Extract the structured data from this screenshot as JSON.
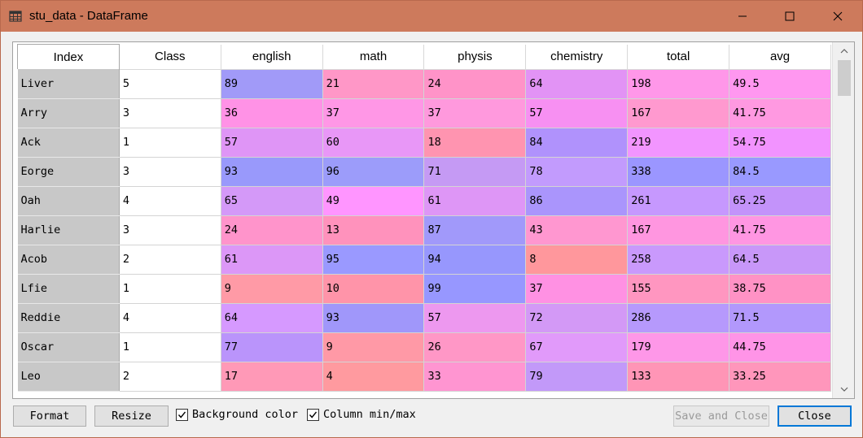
{
  "window": {
    "title": "stu_data - DataFrame"
  },
  "table": {
    "columns": [
      "Index",
      "Class",
      "english",
      "math",
      "physis",
      "chemistry",
      "total",
      "avg"
    ],
    "rows": [
      {
        "cells": [
          "Liver",
          "5",
          "89",
          "21",
          "24",
          "64",
          "198",
          "49.5"
        ],
        "colors": [
          "",
          "",
          "#a19af8",
          "#ff97c7",
          "#ff93c8",
          "#e293f5",
          "#ff97e9",
          "#ff97f0"
        ]
      },
      {
        "cells": [
          "Arry",
          "3",
          "36",
          "37",
          "37",
          "57",
          "167",
          "41.75"
        ],
        "colors": [
          "",
          "",
          "#ff92e6",
          "#ff97e6",
          "#ff99dd",
          "#f790f2",
          "#ff99cf",
          "#ff99e1"
        ]
      },
      {
        "cells": [
          "Ack",
          "1",
          "57",
          "60",
          "18",
          "84",
          "219",
          "54.75"
        ],
        "colors": [
          "",
          "",
          "#df95f6",
          "#e897f7",
          "#ff94b0",
          "#b092fc",
          "#f295ff",
          "#f293ff"
        ]
      },
      {
        "cells": [
          "Eorge",
          "3",
          "93",
          "96",
          "71",
          "78",
          "338",
          "84.5"
        ],
        "colors": [
          "",
          "",
          "#9999fb",
          "#9c9cfa",
          "#c59af4",
          "#c29bfd",
          "#9b96ff",
          "#9999ff"
        ]
      },
      {
        "cells": [
          "Oah",
          "4",
          "65",
          "49",
          "61",
          "86",
          "261",
          "65.25"
        ],
        "colors": [
          "",
          "",
          "#d499f8",
          "#ff95ff",
          "#de96f6",
          "#aa95fc",
          "#c698fe",
          "#c393fa"
        ]
      },
      {
        "cells": [
          "Harlie",
          "3",
          "24",
          "13",
          "87",
          "43",
          "167",
          "41.75"
        ],
        "colors": [
          "",
          "",
          "#ff94cb",
          "#ff92bc",
          "#a199fa",
          "#ff97d0",
          "#ff96e0",
          "#ff96e2"
        ]
      },
      {
        "cells": [
          "Acob",
          "2",
          "61",
          "95",
          "94",
          "8",
          "258",
          "64.5"
        ],
        "colors": [
          "",
          "",
          "#dc97f7",
          "#9a99ff",
          "#9797fd",
          "#ff979c",
          "#c999fc",
          "#c897f9"
        ]
      },
      {
        "cells": [
          "Lfie",
          "1",
          "9",
          "10",
          "99",
          "37",
          "155",
          "38.75"
        ],
        "colors": [
          "",
          "",
          "#ff9aa6",
          "#ff94a9",
          "#9797ff",
          "#ff91e3",
          "#ff96c0",
          "#ff92c5"
        ]
      },
      {
        "cells": [
          "Reddie",
          "4",
          "64",
          "93",
          "57",
          "72",
          "286",
          "71.5"
        ],
        "colors": [
          "",
          "",
          "#d699ff",
          "#a097fa",
          "#ed98ef",
          "#d399f6",
          "#b699fc",
          "#b298fc"
        ]
      },
      {
        "cells": [
          "Oscar",
          "1",
          "77",
          "9",
          "26",
          "67",
          "179",
          "44.75"
        ],
        "colors": [
          "",
          "",
          "#ba94fb",
          "#ff99a6",
          "#ff97c6",
          "#e19afa",
          "#fe97e8",
          "#ff94e7"
        ]
      },
      {
        "cells": [
          "Leo",
          "2",
          "17",
          "4",
          "33",
          "79",
          "133",
          "33.25"
        ],
        "colors": [
          "",
          "",
          "#ff99b7",
          "#ff9a9f",
          "#ff95d1",
          "#c299f9",
          "#ff95b6",
          "#ff96bb"
        ]
      }
    ]
  },
  "buttons": {
    "format": "Format",
    "resize": "Resize",
    "save_and_close": "Save and Close",
    "close": "Close"
  },
  "checkboxes": {
    "background_color": {
      "label": "Background color",
      "checked": true
    },
    "column_min_max": {
      "label": "Column min/max",
      "checked": true
    }
  }
}
